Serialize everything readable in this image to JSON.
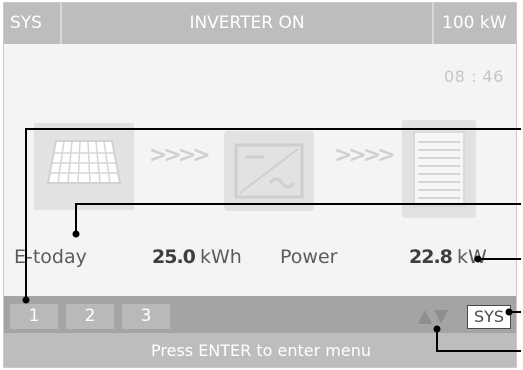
{
  "header": {
    "mode": "SYS",
    "status": "INVERTER ON",
    "rated_power": "100 kW"
  },
  "clock": "08 : 46",
  "flow": {
    "arrows_1": ">>>>",
    "arrows_2": ">>>>"
  },
  "readings": {
    "etoday_label": "E-today",
    "etoday_value": "25.0",
    "etoday_unit": "kWh",
    "power_label": "Power",
    "power_value": "22.8",
    "power_unit": "kW"
  },
  "softkeys": {
    "key1": "1",
    "key2": "2",
    "key3": "3",
    "sys_label": "SYS"
  },
  "footer": {
    "hint": "Press ENTER to enter menu"
  },
  "icons": [
    "solar-panel-icon",
    "inverter-icon",
    "battery-cabinet-icon",
    "up-down-arrows-icon"
  ],
  "colors": {
    "bar": "#bdbdbd",
    "softkey_bar": "#a4a4a4",
    "text": "#5b5b5b",
    "background": "#f4f4f4"
  }
}
